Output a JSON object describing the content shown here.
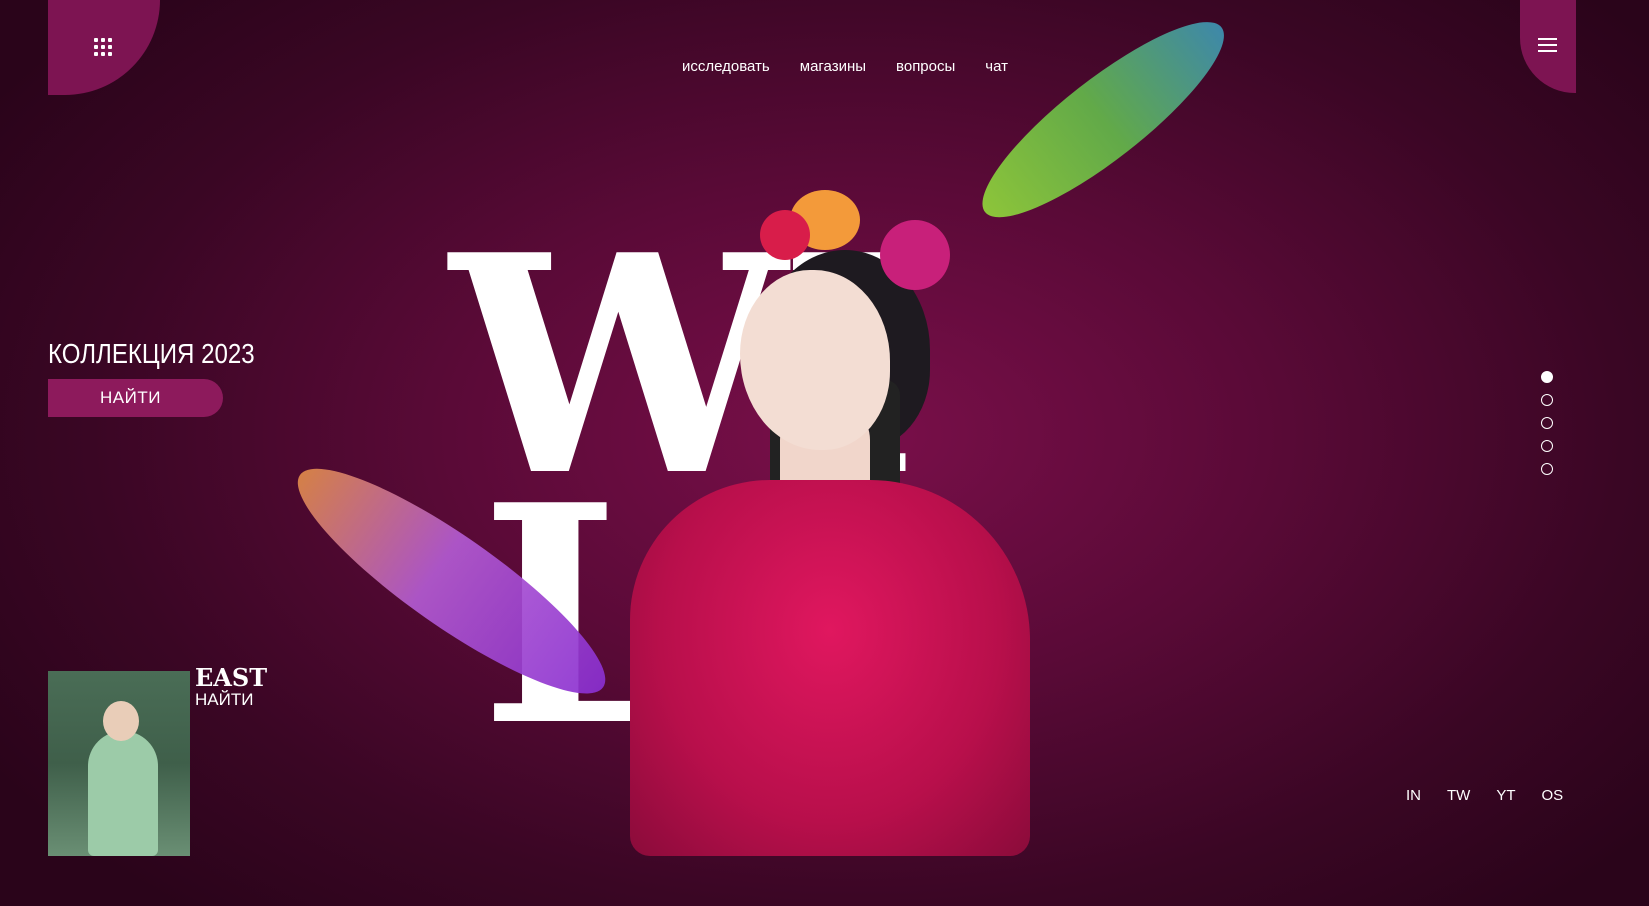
{
  "nav": [
    "исследовать",
    "магазины",
    "вопросы",
    "чат"
  ],
  "hero": {
    "line1": "WI",
    "line2": "LD",
    "collection": "КОЛЛЕКЦИЯ 2023",
    "find_button": "НАЙТИ"
  },
  "thumb_card": {
    "title": "EAST",
    "link": "НАЙТИ"
  },
  "social": [
    "IN",
    "TW",
    "YT",
    "OS"
  ],
  "slider": {
    "count": 5,
    "active_index": 0
  },
  "colors": {
    "accent": "#8d1a5c",
    "background": "#5a0a37"
  }
}
